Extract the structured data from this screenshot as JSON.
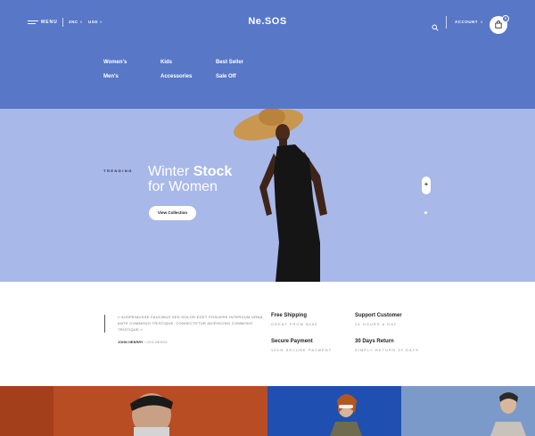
{
  "header": {
    "menu_label": "MENU",
    "currency_1": "ZNC",
    "currency_2": "USD",
    "logo": "Ne.SOS",
    "account_label": "ACCOUNT",
    "cart_count": "0",
    "nav": [
      "Women's",
      "Kids",
      "Best Seller",
      "Men's",
      "Accessories",
      "Sale Off"
    ]
  },
  "hero": {
    "tag": "TRENDING",
    "title_light": "Winter",
    "title_bold": "Stock",
    "title_line2": "for Women",
    "cta": "View Collection",
    "next": "+"
  },
  "info": {
    "quote": "« SUSPENDISSE FAUCIBUS SED DOLOR EGET POSUERE INTERDUM URNA, ANTE COMMODO TRISTIQUE, CONSECTETUR ADIPISCING COMMODO TRISTIQUE »",
    "author_name": "JOHN HENRRY",
    "author_role": "/ CEO NESOS",
    "features": [
      {
        "title": "Free Shipping",
        "sub": "GREAT FROM $450"
      },
      {
        "title": "Support Customer",
        "sub": "24 HOURS A DAY"
      },
      {
        "title": "Secure Payment",
        "sub": "100% SECURE PAYMENT"
      },
      {
        "title": "30 Days Return",
        "sub": "SIMPLY RETURN 30 DAYS"
      }
    ]
  },
  "colors": {
    "header_bg": "#5877c6",
    "hero_bg": "#a8b8e8",
    "band_left": "#b84c22",
    "band_mid": "#1f4fb0",
    "band_right": "#6f8fc4"
  },
  "icons": [
    "hamburger-icon",
    "search-icon",
    "cart-icon",
    "chevron-down-icon",
    "plus-icon"
  ]
}
